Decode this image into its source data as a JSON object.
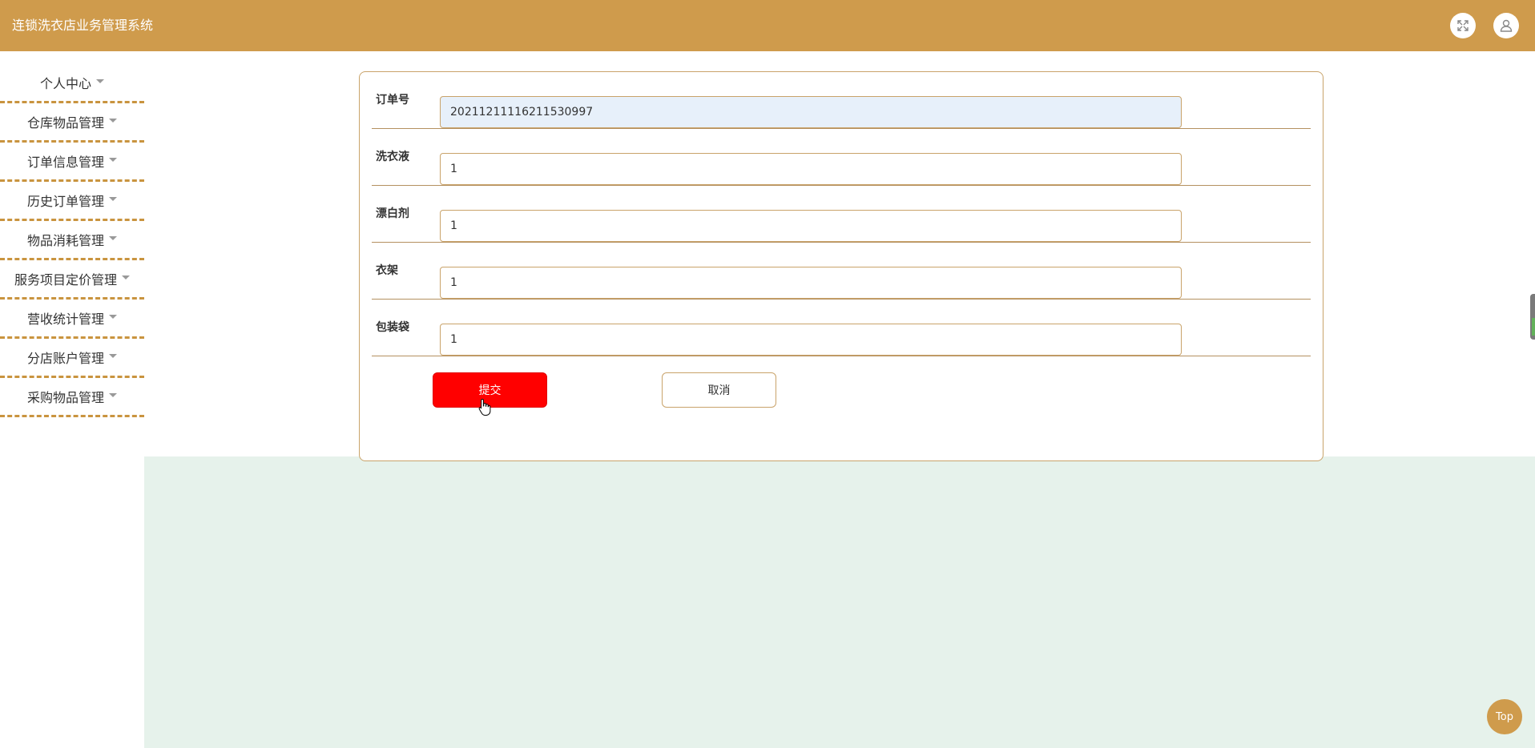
{
  "header": {
    "title": "连锁洗衣店业务管理系统",
    "fullscreen_icon": "expand-icon",
    "user_icon": "user-icon"
  },
  "sidebar": {
    "items": [
      {
        "label": "个人中心"
      },
      {
        "label": "仓库物品管理"
      },
      {
        "label": "订单信息管理"
      },
      {
        "label": "历史订单管理"
      },
      {
        "label": "物品消耗管理"
      },
      {
        "label": "服务项目定价管理"
      },
      {
        "label": "营收统计管理"
      },
      {
        "label": "分店账户管理"
      },
      {
        "label": "采购物品管理"
      }
    ]
  },
  "form": {
    "fields": [
      {
        "label": "订单号",
        "value": "20211211116211530997",
        "readonly": true
      },
      {
        "label": "洗衣液",
        "value": "1"
      },
      {
        "label": "漂白剂",
        "value": "1"
      },
      {
        "label": "衣架",
        "value": "1"
      },
      {
        "label": "包装袋",
        "value": "1"
      }
    ],
    "submit_label": "提交",
    "cancel_label": "取消"
  },
  "top_button": {
    "label": "Top"
  },
  "colors": {
    "header_bg": "#cf9b4c",
    "submit_bg": "#ff0000",
    "main_bg": "#e6f2eb",
    "border": "#c9a36a"
  }
}
